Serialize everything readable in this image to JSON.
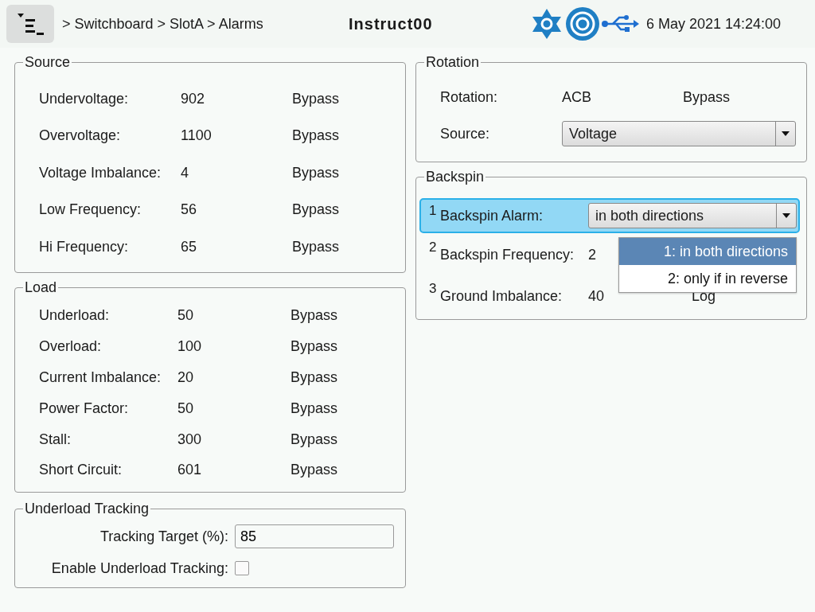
{
  "header": {
    "breadcrumb": "> Switchboard > SlotA > Alarms",
    "title": "Instruct00",
    "datetime": "6 May 2021 14:24:00"
  },
  "source": {
    "title": "Source",
    "rows": [
      {
        "label": "Undervoltage:",
        "value": "902",
        "action": "Bypass"
      },
      {
        "label": "Overvoltage:",
        "value": "1100",
        "action": "Bypass"
      },
      {
        "label": "Voltage Imbalance:",
        "value": "4",
        "action": "Bypass"
      },
      {
        "label": "Low Frequency:",
        "value": "56",
        "action": "Bypass"
      },
      {
        "label": "Hi Frequency:",
        "value": "65",
        "action": "Bypass"
      }
    ]
  },
  "load": {
    "title": "Load",
    "rows": [
      {
        "label": "Underload:",
        "value": "50",
        "action": "Bypass"
      },
      {
        "label": "Overload:",
        "value": "100",
        "action": "Bypass"
      },
      {
        "label": "Current Imbalance:",
        "value": "20",
        "action": "Bypass"
      },
      {
        "label": "Power Factor:",
        "value": "50",
        "action": "Bypass"
      },
      {
        "label": "Stall:",
        "value": "300",
        "action": "Bypass"
      },
      {
        "label": "Short Circuit:",
        "value": "601",
        "action": "Bypass"
      }
    ]
  },
  "underload_tracking": {
    "title": "Underload Tracking",
    "target_label": "Tracking Target (%):",
    "target_value": "85",
    "enable_label": "Enable Underload Tracking:",
    "enable_checked": false
  },
  "rotation": {
    "title": "Rotation",
    "rows": [
      {
        "kind": "text",
        "label": "Rotation:",
        "value": "ACB",
        "action": "Bypass"
      },
      {
        "kind": "select",
        "label": "Source:",
        "value": "Voltage"
      }
    ]
  },
  "backspin": {
    "title": "Backspin",
    "rows": [
      {
        "kind": "select",
        "number": "1",
        "label": "Backspin Alarm:",
        "value": "in both directions",
        "selected": true
      },
      {
        "kind": "text",
        "number": "2",
        "label": "Backspin Frequency:",
        "value": "2",
        "selected": false
      },
      {
        "kind": "text",
        "number": "3",
        "label": "Ground Imbalance:",
        "value": "40",
        "action": "Log",
        "selected": false
      }
    ]
  },
  "dropdown": {
    "options": [
      {
        "label": "1: in both directions",
        "selected": true
      },
      {
        "label": "2: only if in reverse",
        "selected": false
      }
    ]
  }
}
